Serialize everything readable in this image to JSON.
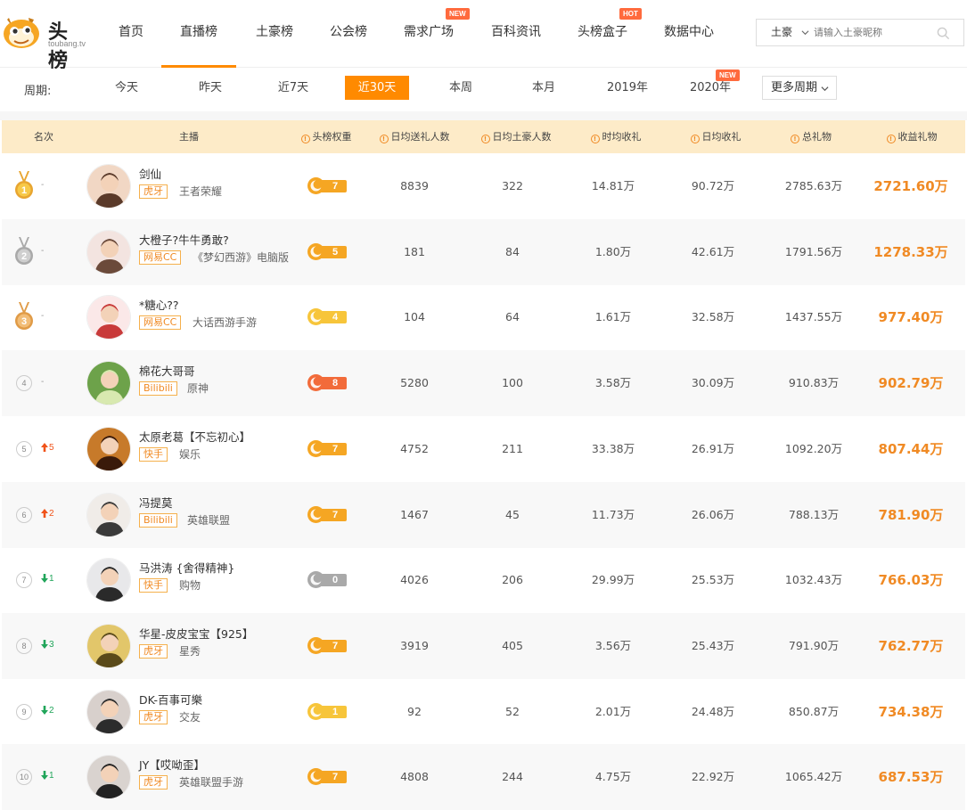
{
  "brand": {
    "name": "头榜",
    "sub": "toubang.tv"
  },
  "nav": {
    "items": [
      {
        "label": "首页"
      },
      {
        "label": "直播榜",
        "active": true
      },
      {
        "label": "土豪榜"
      },
      {
        "label": "公会榜"
      },
      {
        "label": "需求广场",
        "badge": "NEW"
      },
      {
        "label": "百科资讯"
      },
      {
        "label": "头榜盒子",
        "badge": "HOT"
      },
      {
        "label": "数据中心"
      }
    ]
  },
  "search": {
    "scope": "土豪",
    "placeholder": "请输入土豪昵称"
  },
  "period": {
    "label": "周期:",
    "options": [
      "今天",
      "昨天",
      "近7天",
      "近30天",
      "本周",
      "本月",
      "2019年",
      "2020年"
    ],
    "selected": "近30天",
    "new_badge": "NEW",
    "more": "更多周期"
  },
  "table": {
    "headers": [
      "名次",
      "主播",
      "头榜权重",
      "日均送礼人数",
      "日均土豪人数",
      "时均收礼",
      "日均收礼",
      "总礼物",
      "收益礼物"
    ],
    "rows": [
      {
        "rank": "1",
        "trend": "-",
        "trend_dir": "flat",
        "name": "剑仙",
        "platform": "虎牙",
        "game": "王者荣耀",
        "weight": "7",
        "weight_color": "#f5a623",
        "gift_users": "8839",
        "rich_users": "322",
        "hourly": "14.81万",
        "daily": "90.72万",
        "total": "2785.63万",
        "income": "2721.60万"
      },
      {
        "rank": "2",
        "trend": "-",
        "trend_dir": "flat",
        "name": "大橙子?牛牛勇敢?",
        "platform": "网易CC",
        "game": "《梦幻西游》电脑版",
        "weight": "5",
        "weight_color": "#f5a623",
        "gift_users": "181",
        "rich_users": "84",
        "hourly": "1.80万",
        "daily": "42.61万",
        "total": "1791.56万",
        "income": "1278.33万"
      },
      {
        "rank": "3",
        "trend": "-",
        "trend_dir": "flat",
        "name": "*糖心??",
        "platform": "网易CC",
        "game": "大话西游手游",
        "weight": "4",
        "weight_color": "#f7c53a",
        "gift_users": "104",
        "rich_users": "64",
        "hourly": "1.61万",
        "daily": "32.58万",
        "total": "1437.55万",
        "income": "977.40万"
      },
      {
        "rank": "4",
        "trend": "-",
        "trend_dir": "flat",
        "name": "棉花大哥哥",
        "platform": "Bilibili",
        "game": "原神",
        "weight": "8",
        "weight_color": "#f26b3a",
        "gift_users": "5280",
        "rich_users": "100",
        "hourly": "3.58万",
        "daily": "30.09万",
        "total": "910.83万",
        "income": "902.79万"
      },
      {
        "rank": "5",
        "trend": "5",
        "trend_dir": "up",
        "name": "太原老葛【不忘初心】",
        "platform": "快手",
        "game": "娱乐",
        "weight": "7",
        "weight_color": "#f5a623",
        "gift_users": "4752",
        "rich_users": "211",
        "hourly": "33.38万",
        "daily": "26.91万",
        "total": "1092.20万",
        "income": "807.44万"
      },
      {
        "rank": "6",
        "trend": "2",
        "trend_dir": "up",
        "name": "冯提莫",
        "platform": "Bilibili",
        "game": "英雄联盟",
        "weight": "7",
        "weight_color": "#f5a623",
        "gift_users": "1467",
        "rich_users": "45",
        "hourly": "11.73万",
        "daily": "26.06万",
        "total": "788.13万",
        "income": "781.90万"
      },
      {
        "rank": "7",
        "trend": "1",
        "trend_dir": "down",
        "name": "马洪涛 {舍得精神}",
        "platform": "快手",
        "game": "购物",
        "weight": "0",
        "weight_color": "#a9a9a9",
        "gift_users": "4026",
        "rich_users": "206",
        "hourly": "29.99万",
        "daily": "25.53万",
        "total": "1032.43万",
        "income": "766.03万"
      },
      {
        "rank": "8",
        "trend": "3",
        "trend_dir": "down",
        "name": "华星-皮皮宝宝【925】",
        "platform": "虎牙",
        "game": "星秀",
        "weight": "7",
        "weight_color": "#f5a623",
        "gift_users": "3919",
        "rich_users": "405",
        "hourly": "3.56万",
        "daily": "25.43万",
        "total": "791.90万",
        "income": "762.77万"
      },
      {
        "rank": "9",
        "trend": "2",
        "trend_dir": "down",
        "name": "DK-百事可樂",
        "platform": "虎牙",
        "game": "交友",
        "weight": "1",
        "weight_color": "#f7c53a",
        "gift_users": "92",
        "rich_users": "52",
        "hourly": "2.01万",
        "daily": "24.48万",
        "total": "850.87万",
        "income": "734.38万"
      },
      {
        "rank": "10",
        "trend": "1",
        "trend_dir": "down",
        "name": "JY【哎呦歪】",
        "platform": "虎牙",
        "game": "英雄联盟手游",
        "weight": "7",
        "weight_color": "#f5a623",
        "gift_users": "4808",
        "rich_users": "244",
        "hourly": "4.75万",
        "daily": "22.92万",
        "total": "1065.42万",
        "income": "687.53万"
      }
    ]
  },
  "colors": {
    "accent": "#ff8a00",
    "header_bg": "#fdebc8",
    "income": "#f08a24",
    "up": "#f0531a",
    "down": "#21a55a"
  }
}
